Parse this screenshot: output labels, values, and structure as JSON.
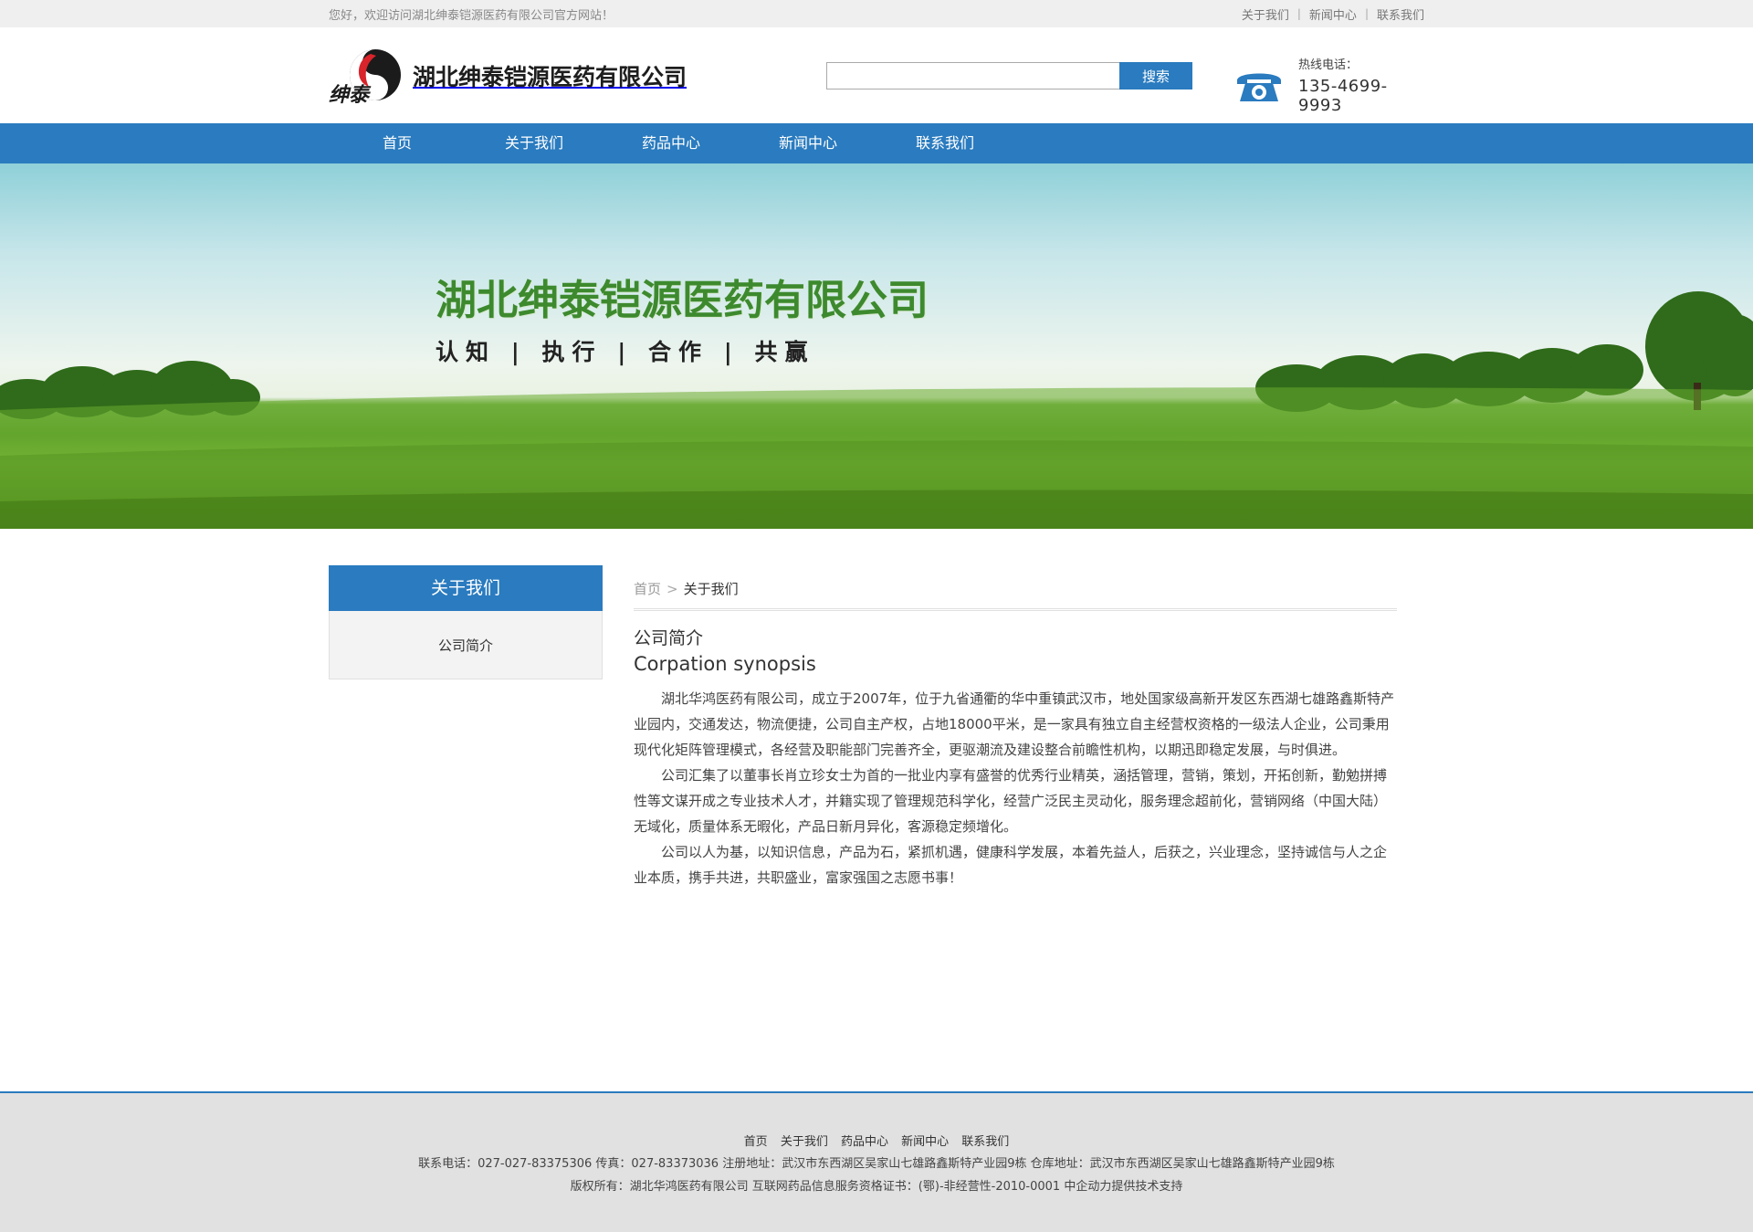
{
  "topbar": {
    "welcome": "您好，欢迎访问湖北绅泰铠源医药有限公司官方网站！",
    "links": [
      "关于我们",
      "新闻中心",
      "联系我们"
    ]
  },
  "header": {
    "company_name": "湖北绅泰铠源医药有限公司",
    "logo_text": "绅泰",
    "search_value": "",
    "search_button": "搜索",
    "hotline_label": "热线电话：",
    "hotline_number": "135-4699-9993"
  },
  "nav": {
    "items": [
      "首页",
      "关于我们",
      "药品中心",
      "新闻中心",
      "联系我们"
    ]
  },
  "banner": {
    "title": "湖北绅泰铠源医药有限公司",
    "slogan": "认知 | 执行 | 合作 | 共赢"
  },
  "sidebar": {
    "heading": "关于我们",
    "items": [
      "公司简介"
    ]
  },
  "content": {
    "breadcrumb_home": "首页",
    "breadcrumb_sep": ">",
    "breadcrumb_current": "关于我们",
    "title_cn": "公司简介",
    "title_en": "Corpation synopsis",
    "paragraphs": [
      "湖北华鸿医药有限公司，成立于2007年，位于九省通衢的华中重镇武汉市，地处国家级高新开发区东西湖七雄路鑫斯特产业园内，交通发达，物流便捷，公司自主产权，占地18000平米，是一家具有独立自主经营权资格的一级法人企业，公司秉用现代化矩阵管理模式，各经营及职能部门完善齐全，更驱潮流及建设整合前瞻性机构，以期迅即稳定发展，与时俱进。",
      "公司汇集了以董事长肖立珍女士为首的一批业内享有盛誉的优秀行业精英，涵括管理，营销，策划，开拓创新，勤勉拼搏性等文谋开成之专业技术人才，并籍实现了管理规范科学化，经营广泛民主灵动化，服务理念超前化，营销网络（中国大陆）无域化，质量体系无暇化，产品日新月异化，客源稳定频增化。",
      "公司以人为基，以知识信息，产品为石，紧抓机遇，健康科学发展，本着先益人，后获之，兴业理念，坚持诚信与人之企业本质，携手共进，共职盛业，富家强国之志愿书事！"
    ]
  },
  "footer": {
    "links": [
      "首页",
      "关于我们",
      "药品中心",
      "新闻中心",
      "联系我们"
    ],
    "contact_line": "联系电话：027-027-83375306 传真：027-83373036 注册地址：武汉市东西湖区吴家山七雄路鑫斯特产业园9栋 仓库地址：武汉市东西湖区吴家山七雄路鑫斯特产业园9栋",
    "copyright_line": "版权所有：湖北华鸿医药有限公司 互联网药品信息服务资格证书：(鄂)-非经营性-2010-0001 中企动力提供技术支持"
  },
  "colors": {
    "accent": "#2a7bbf",
    "banner_title": "#3d8a2e",
    "footer_bg": "#e1e1e1"
  },
  "icons": {
    "logo": "logo-mark-icon",
    "phone": "telephone-icon"
  }
}
